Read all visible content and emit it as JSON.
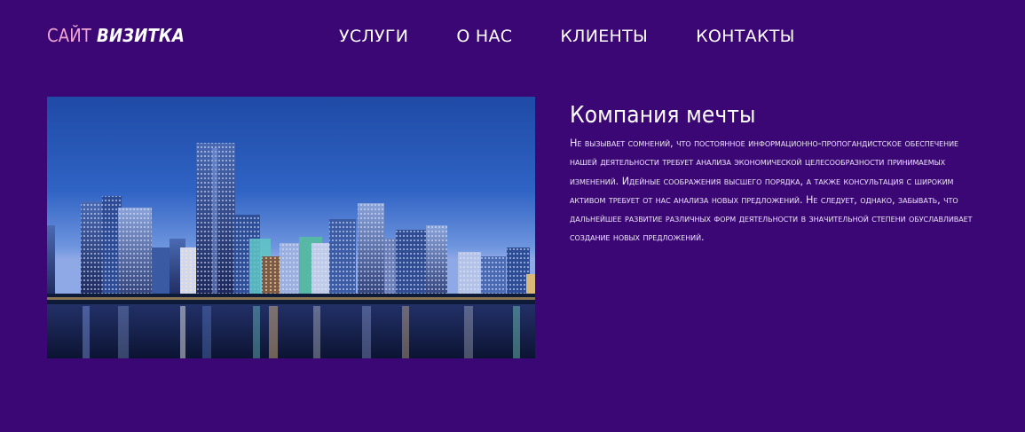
{
  "logo": {
    "part1": "САЙТ",
    "part2": "ВИЗИТКА"
  },
  "nav": {
    "items": [
      {
        "label": "УСЛУГИ"
      },
      {
        "label": "О НАС"
      },
      {
        "label": "КЛИЕНТЫ"
      },
      {
        "label": "КОНТАКТЫ"
      }
    ]
  },
  "hero": {
    "image": "city-skyline-night-photo"
  },
  "content": {
    "title": "Компания мечты",
    "text": "Не вызывает сомнений, что постоянное информационно-пропогандистское обеспечение нашей деятельности требует анализа экономической целесообразности принимаемых изменений. Идейные соображения высшего порядка, а также консультация с широким активом требует от нас анализа новых предложений. Не следует, однако, забывать, что дальнейшее развитие различных форм деятельности в значительной степени обуславливает создание новых предложений."
  },
  "colors": {
    "background": "#3b0775",
    "logo_accent": "#f2a6d4",
    "text": "#ffffff"
  }
}
